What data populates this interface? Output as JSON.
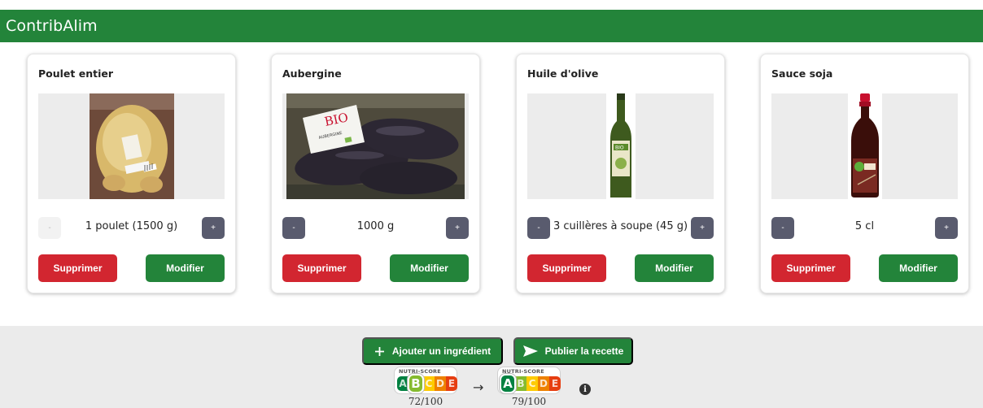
{
  "app": {
    "title": "ContribAlim"
  },
  "ingredients": [
    {
      "name": "Poulet entier",
      "quantity": "1 poulet (1500 g)",
      "minus_label": "-",
      "plus_label": "+",
      "minus_disabled": true,
      "delete_label": "Supprimer",
      "edit_label": "Modifier",
      "image": "poulet-entier-photo"
    },
    {
      "name": "Aubergine",
      "quantity": "1000 g",
      "minus_label": "-",
      "plus_label": "+",
      "minus_disabled": false,
      "delete_label": "Supprimer",
      "edit_label": "Modifier",
      "image": "aubergine-photo"
    },
    {
      "name": "Huile d'olive",
      "quantity": "3 cuillères à soupe (45 g)",
      "minus_label": "-",
      "plus_label": "+",
      "minus_disabled": false,
      "delete_label": "Supprimer",
      "edit_label": "Modifier",
      "image": "huile-olive-photo"
    },
    {
      "name": "Sauce soja",
      "quantity": "5 cl",
      "minus_label": "-",
      "plus_label": "+",
      "minus_disabled": false,
      "delete_label": "Supprimer",
      "edit_label": "Modifier",
      "image": "sauce-soja-photo"
    }
  ],
  "footer": {
    "add_label": "Ajouter un ingrédient",
    "publish_label": "Publier la recette",
    "nutriscore_before": {
      "label": "NUTRI-SCORE",
      "grade": "B",
      "score": "72/100"
    },
    "nutriscore_after": {
      "label": "NUTRI-SCORE",
      "grade": "A",
      "score": "79/100"
    },
    "arrow": "→",
    "info": "i"
  },
  "colors": {
    "brand_green": "#23843a",
    "delete_red": "#d22630",
    "stepper": "#595b6e",
    "nutri_a": "#038141",
    "nutri_b": "#85bb2f",
    "nutri_c": "#fecb02",
    "nutri_d": "#ee8100",
    "nutri_e": "#e63e11"
  }
}
